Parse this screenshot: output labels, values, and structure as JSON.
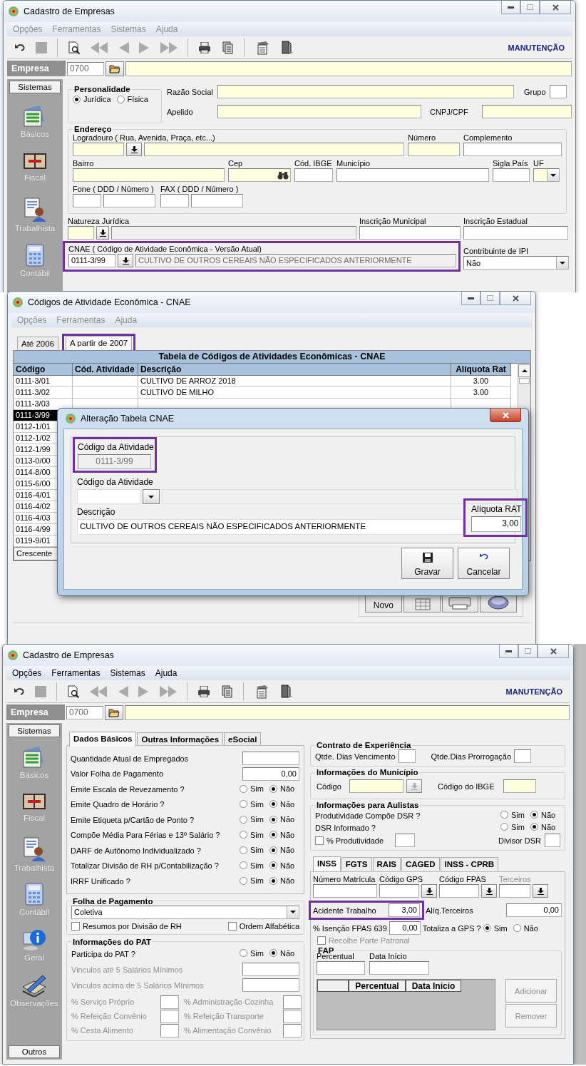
{
  "window_cadastro": {
    "title": "Cadastro de Empresas",
    "menu": [
      {
        "label": "Opções",
        "disabled": true
      },
      {
        "label": "Ferramentas",
        "disabled": true
      },
      {
        "label": "Sistemas",
        "disabled": true
      },
      {
        "label": "Ajuda",
        "disabled": true
      }
    ],
    "mode": "MANUTENÇÃO",
    "empresa": {
      "label": "Empresa",
      "code": "0700"
    },
    "sidebar": {
      "header": "Sistemas",
      "items": [
        "Básicos",
        "Fiscal",
        "Trabalhista",
        "Contábil"
      ]
    },
    "personalidade": {
      "title": "Personalidade",
      "options": [
        {
          "label": "Jurídica",
          "selected": true
        },
        {
          "label": "Física",
          "selected": false
        }
      ]
    },
    "identity": {
      "razao_social": "Razão Social",
      "grupo": "Grupo",
      "apelido": "Apelido",
      "cnpj_cpf": "CNPJ/CPF"
    },
    "endereco": {
      "title": "Endereço",
      "logradouro": "Logradouro ( Rua, Avenida, Praça, etc...)",
      "numero": "Número",
      "complemento": "Complemento",
      "bairro": "Bairro",
      "cep": "Cep",
      "cod_ibge": "Cód. IBGE",
      "municipio": "Município",
      "sigla_pais": "Sigla País",
      "uf": "UF",
      "fone": "Fone ( DDD / Número )",
      "fax": "FAX ( DDD / Número )"
    },
    "natureza_juridica": "Natureza Jurídica",
    "inscricao_municipal": "Inscrição Municipal",
    "inscricao_estadual": "Inscrição Estadual",
    "cnae": {
      "label": "CNAE ( Código de Atividade Econômica - Versão Atual)",
      "code": "0111-3/99",
      "description": "CULTIVO DE OUTROS CEREAIS NÃO ESPECIFICADOS ANTERIORMENTE",
      "highlighted": true
    },
    "contribuinte_ipi": {
      "label": "Contribuinte de IPI",
      "value": "Não"
    }
  },
  "window_cnae": {
    "title": "Códigos de Atividade Econômica - CNAE",
    "menu": [
      {
        "label": "Opções",
        "disabled": true
      },
      {
        "label": "Ferramentas",
        "disabled": true
      },
      {
        "label": "Ajuda",
        "disabled": true
      }
    ],
    "tabs": [
      {
        "label": "Até 2006",
        "selected": false,
        "highlighted": false
      },
      {
        "label": "A partir de 2007",
        "selected": true,
        "highlighted": true
      }
    ],
    "table": {
      "title": "Tabela de Códigos de Atividades Econômicas - CNAE",
      "columns": [
        "Código",
        "Cód. Atividade",
        "Descrição",
        "Alíquota Rat"
      ],
      "rows": [
        {
          "code": "0111-3/01",
          "description": "CULTIVO DE ARROZ 2018",
          "rate": "3.00",
          "selected": false
        },
        {
          "code": "0111-3/02",
          "description": "CULTIVO DE MILHO",
          "rate": "3.00",
          "selected": false
        },
        {
          "code": "0111-3/03",
          "selected": false
        },
        {
          "code": "0111-3/99",
          "selected": true
        },
        {
          "code": "0112-1/01",
          "selected": false
        },
        {
          "code": "0112-1/02",
          "selected": false
        },
        {
          "code": "0112-1/99",
          "selected": false
        },
        {
          "code": "0113-0/00",
          "selected": false
        },
        {
          "code": "0114-8/00",
          "selected": false
        },
        {
          "code": "0115-6/00",
          "selected": false
        },
        {
          "code": "0116-4/01",
          "selected": false
        },
        {
          "code": "0116-4/02",
          "selected": false
        },
        {
          "code": "0116-4/03",
          "selected": false
        },
        {
          "code": "0116-4/99",
          "selected": false
        },
        {
          "code": "0119-9/01",
          "selected": false
        }
      ],
      "footer": "Crescente"
    },
    "new_button": "Novo",
    "dialog": {
      "title": "Alteração Tabela CNAE",
      "codigo": {
        "label": "Código da Atividade",
        "value": "0111-3/99",
        "disabled": true,
        "highlighted": true
      },
      "codigo_novo": {
        "label": "Código da Atividade"
      },
      "descricao": {
        "label": "Descrição",
        "value": "CULTIVO DE OUTROS CEREAIS NÃO ESPECIFICADOS ANTERIORMENTE"
      },
      "aliquota": {
        "label": "Alíquota RAT",
        "value": "3,00",
        "highlighted": true
      },
      "buttons": [
        "Gravar",
        "Cancelar"
      ]
    }
  },
  "window_cadastro_inss": {
    "title": "Cadastro de Empresas",
    "menu": [
      {
        "label": "Opções",
        "disabled": false
      },
      {
        "label": "Ferramentas",
        "disabled": false
      },
      {
        "label": "Sistemas",
        "disabled": false
      },
      {
        "label": "Ajuda",
        "disabled": false
      }
    ],
    "mode": "MANUTENÇÃO",
    "empresa": {
      "label": "Empresa",
      "code": "0700"
    },
    "sidebar": {
      "header": "Sistemas",
      "items": [
        "Básicos",
        "Fiscal",
        "Trabalhista",
        "Contábil",
        "Geral",
        "Observações"
      ],
      "footer": "Outros"
    },
    "tabs": [
      {
        "label": "Dados Básicos",
        "selected": true
      },
      {
        "label": "Outras Informações",
        "selected": false
      },
      {
        "label": "eSocial",
        "selected": false
      }
    ],
    "basic": [
      {
        "kind": "field",
        "label": "Quantidade Atual de Empregados"
      },
      {
        "kind": "field",
        "label": "Valor Folha de Pagamento",
        "value": "0,00"
      },
      {
        "kind": "yesno",
        "label": "Emite Escala de Revezamento ?",
        "options": [
          {
            "label": "Sim",
            "selected": false
          },
          {
            "label": "Não",
            "selected": true
          }
        ]
      },
      {
        "kind": "yesno",
        "label": "Emite Quadro de Horário ?",
        "options": [
          {
            "label": "Sim",
            "selected": false
          },
          {
            "label": "Não",
            "selected": true
          }
        ]
      },
      {
        "kind": "yesno",
        "label": "Emite Etiqueta p/Cartão de Ponto ?",
        "options": [
          {
            "label": "Sim",
            "selected": false
          },
          {
            "label": "Não",
            "selected": true
          }
        ]
      },
      {
        "kind": "yesno",
        "label": "Compõe Média Para Férias e 13º Salário ?",
        "options": [
          {
            "label": "Sim",
            "selected": false
          },
          {
            "label": "Não",
            "selected": true
          }
        ]
      },
      {
        "kind": "yesno",
        "label": "DARF de Autônomo Individualizado ?",
        "options": [
          {
            "label": "Sim",
            "selected": false
          },
          {
            "label": "Não",
            "selected": true
          }
        ]
      },
      {
        "kind": "yesno",
        "label": "Totalizar Divisão de RH p/Contabilização ?",
        "options": [
          {
            "label": "Sim",
            "selected": false
          },
          {
            "label": "Não",
            "selected": true
          }
        ]
      },
      {
        "kind": "yesno",
        "label": "IRRF Unificado ?",
        "options": [
          {
            "label": "Sim",
            "selected": false
          },
          {
            "label": "Não",
            "selected": true
          }
        ]
      }
    ],
    "folha": {
      "title": "Folha de Pagamento",
      "value": "Coletiva",
      "checks": [
        {
          "label": "Resumos por Divisão de RH",
          "checked": false
        },
        {
          "label": "Ordem Alfabética",
          "checked": false
        }
      ]
    },
    "pat": {
      "title": "Informações do PAT",
      "question": {
        "label": "Participa do PAT ?",
        "options": [
          {
            "label": "Sim",
            "selected": false
          },
          {
            "label": "Não",
            "selected": true
          }
        ]
      },
      "vinculos": [
        {
          "label": "Vinculos até 5 Salários Mínimos",
          "disabled": true
        },
        {
          "label": "Vinculos acima de 5 Salários Mínimos",
          "disabled": true
        }
      ],
      "percent": [
        {
          "label": "% Serviço Próprio",
          "disabled": true
        },
        {
          "label": "% Administração Cozinha",
          "disabled": true
        },
        {
          "label": "% Refeição Convênio",
          "disabled": true
        },
        {
          "label": "% Refeição Transporte",
          "disabled": true
        },
        {
          "label": "% Cesta Alimento",
          "disabled": true
        },
        {
          "label": "% Alimentação Convênio",
          "disabled": true
        }
      ]
    },
    "contrato": {
      "title": "Contrato de Experiência",
      "fields": [
        "Qtde. Dias Vencimento",
        "Qtde.Dias Prorrogação"
      ]
    },
    "municipio": {
      "title": "Informações do Município",
      "codigo": "Código",
      "ibge": "Código do IBGE"
    },
    "aulistas": {
      "title": "Informações para Aulistas",
      "questions": [
        {
          "label": "Produtividade Compõe DSR ?",
          "options": [
            {
              "label": "Sim",
              "selected": false
            },
            {
              "label": "Não",
              "selected": true
            }
          ]
        },
        {
          "label": "DSR Informado ?",
          "options": [
            {
              "label": "Sim",
              "selected": false
            },
            {
              "label": "Não",
              "selected": true
            }
          ]
        }
      ],
      "produtividade": {
        "label": "% Produtividade",
        "checked": false
      },
      "divisor": "Divisor DSR"
    },
    "inss_tabs": [
      {
        "label": "INSS",
        "selected": true
      },
      {
        "label": "FGTS",
        "selected": false
      },
      {
        "label": "RAIS",
        "selected": false
      },
      {
        "label": "CAGED",
        "selected": false
      },
      {
        "label": "INSS - CPRB",
        "selected": false
      }
    ],
    "inss": {
      "matricula": {
        "label": "Número Matrícula",
        "disabled": false
      },
      "gps": {
        "label": "Código GPS",
        "disabled": false
      },
      "fpas": {
        "label": "Código FPAS",
        "disabled": false
      },
      "terceiros": {
        "label": "Terceiros",
        "disabled": true
      },
      "acidente": {
        "label": "Acidente Trabalho",
        "value": "3,00",
        "highlighted": true
      },
      "aliq_terceiros": {
        "label": "Alíq.Terceiros",
        "value": "0,00"
      },
      "isencao": {
        "label": "% Isenção FPAS 639",
        "value": "0,00"
      },
      "totaliza": {
        "label": "Totaliza a GPS ?",
        "options": [
          {
            "label": "Sim",
            "selected": true
          },
          {
            "label": "Não",
            "selected": false
          }
        ]
      },
      "recolhe": {
        "label": "Recolhe Parte Patronal",
        "checked": false,
        "disabled": true
      },
      "fap": {
        "title": "FAP",
        "fields": [
          "Percentual",
          "Data Início"
        ],
        "columns": [
          "Percentual",
          "Data Início"
        ],
        "buttons": [
          {
            "label": "Adicionar",
            "disabled": true
          },
          {
            "label": "Remover",
            "disabled": true
          }
        ]
      }
    }
  }
}
